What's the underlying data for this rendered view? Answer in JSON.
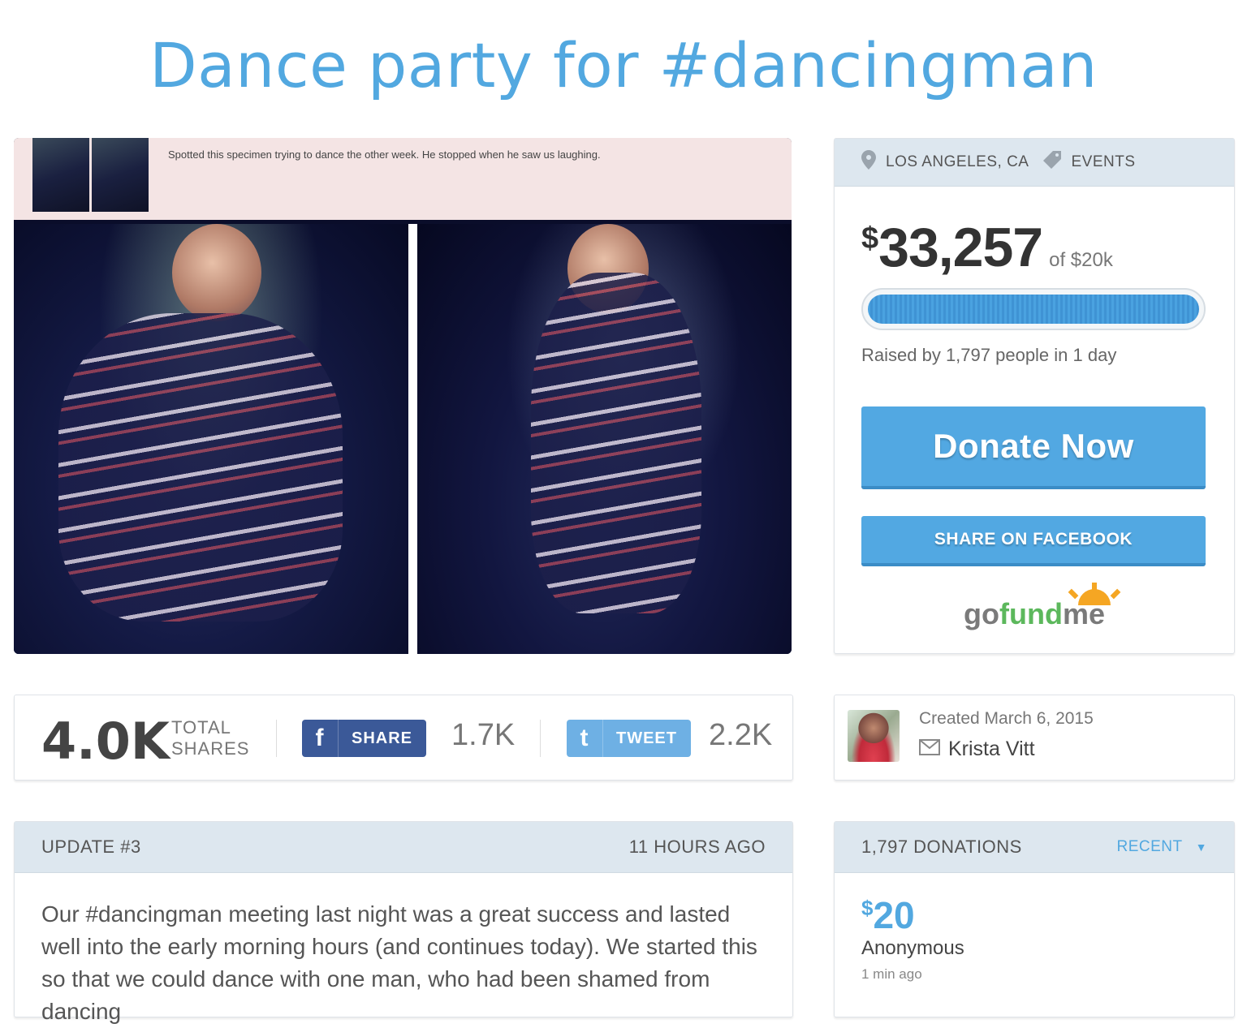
{
  "title": "Dance party for #dancingman",
  "photo": {
    "caption": "Spotted this specimen trying to dance the other week. He stopped when he saw us laughing."
  },
  "campaign": {
    "location": "LOS ANGELES, CA",
    "category": "EVENTS",
    "currency": "$",
    "amount": "33,257",
    "goal": "of $20k",
    "progress_fraction": 1.0,
    "raised_by": "Raised by 1,797 people in 1 day",
    "donate_label": "Donate Now",
    "share_facebook_label": "SHARE ON FACEBOOK",
    "logo_text": "gofundme",
    "logo_part1": "go",
    "logo_part2": "fund",
    "logo_part3": "me",
    "accent_color": "#52a8e2"
  },
  "shares": {
    "total": "4.0K",
    "total_label_1": "TOTAL",
    "total_label_2": "SHARES",
    "facebook_label": "SHARE",
    "facebook_count": "1.7K",
    "twitter_label": "TWEET",
    "twitter_count": "2.2K"
  },
  "creator": {
    "created": "Created March 6, 2015",
    "name": "Krista Vitt"
  },
  "update": {
    "label": "UPDATE #3",
    "time": "11 HOURS AGO",
    "text": "Our #dancingman meeting last night was a great success and lasted well into the early morning hours (and continues today). We started this so that we could dance with one man, who had been shamed from dancing"
  },
  "donations": {
    "header": "1,797 DONATIONS",
    "sort_label": "RECENT",
    "items": [
      {
        "currency": "$",
        "amount": "20",
        "name": "Anonymous",
        "time": "1 min ago"
      }
    ]
  }
}
